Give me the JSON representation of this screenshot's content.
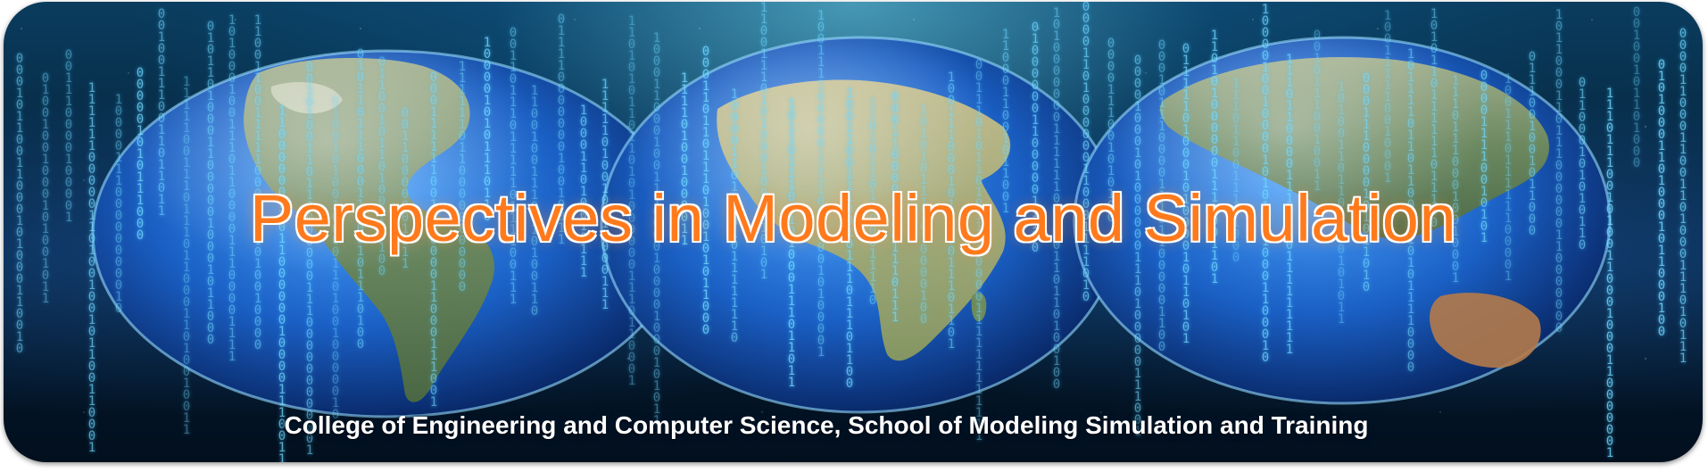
{
  "banner": {
    "title": "Perspectives in Modeling and Simulation",
    "subtitle": "College of Engineering and Computer Science, School of Modeling Simulation and Training"
  },
  "colors": {
    "title_fill": "#ff7a1c",
    "title_outline": "#ffffff",
    "subtitle": "#ffffff",
    "background_dark": "#020f1e",
    "ocean_blue": "#1e6fd0",
    "land_green": "#7a9a6a",
    "binary_glow": "#78dcff"
  },
  "icons": [
    "globe-americas",
    "globe-africa-europe",
    "globe-asia-australia",
    "binary-code-rain"
  ]
}
